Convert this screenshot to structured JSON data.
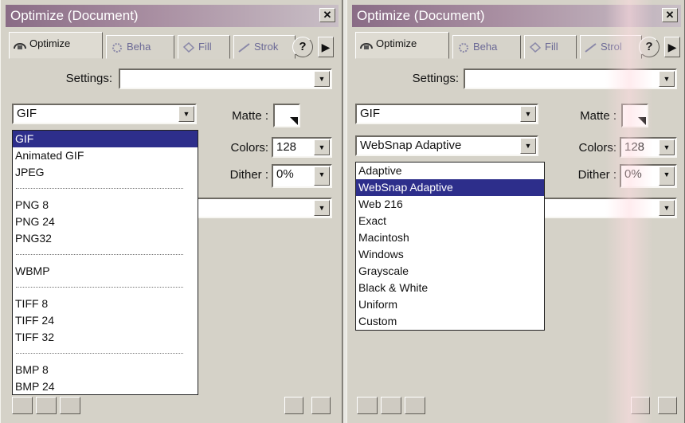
{
  "panels": [
    {
      "title": "Optimize (Document)",
      "tabs": [
        "Optimize",
        "Beha",
        "Fill",
        "Strok"
      ],
      "settings_label": "Settings:",
      "settings_value": "",
      "format_value": "GIF",
      "matte_label": "Matte :",
      "colors_label": "Colors:",
      "colors_value": "128",
      "dither_label": "Dither :",
      "dither_value": "0%",
      "dropdown": {
        "selected": "GIF",
        "options": [
          "GIF",
          "Animated GIF",
          "JPEG",
          "---",
          "PNG 8",
          "PNG 24",
          "PNG32",
          "---",
          "WBMP",
          "---",
          "TIFF 8",
          "TIFF 24",
          "TIFF 32",
          "---",
          "BMP 8",
          "BMP 24"
        ]
      }
    },
    {
      "title": "Optimize (Document)",
      "tabs": [
        "Optimize",
        "Beha",
        "Fill",
        "Strol"
      ],
      "settings_label": "Settings:",
      "settings_value": "",
      "format_value": "GIF",
      "palette_value": "WebSnap Adaptive",
      "matte_label": "Matte :",
      "colors_label": "Colors:",
      "colors_value": "128",
      "dither_label": "Dither :",
      "dither_value": "0%",
      "dropdown": {
        "selected": "WebSnap Adaptive",
        "options": [
          "Adaptive",
          "WebSnap Adaptive",
          "Web 216",
          "Exact",
          "Macintosh",
          "Windows",
          "Grayscale",
          "Black & White",
          "Uniform",
          "Custom"
        ]
      }
    }
  ],
  "icons": {
    "close": "close-icon",
    "help": "help-icon",
    "menu_arrow": "triangle-right-icon",
    "dropdown": "chevron-down-icon",
    "save": "floppy-disk-icon",
    "delete": "trash-icon"
  },
  "colors": {
    "titlebar": "#8a6c86",
    "selection": "#2d2e8b",
    "panel_bg": "#d5d2c8"
  }
}
